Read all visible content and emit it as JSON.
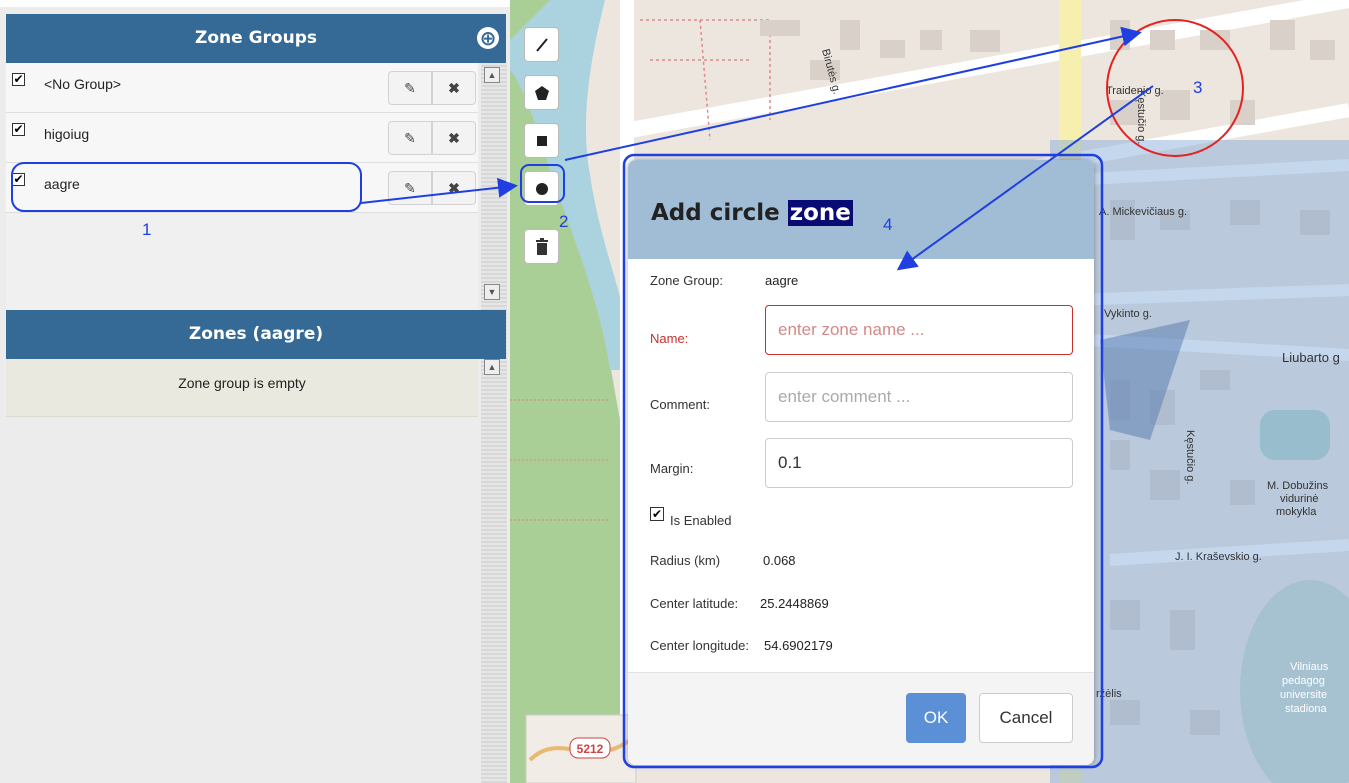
{
  "zone_groups": {
    "title": "Zone Groups",
    "add_symbol": "⊕",
    "edit_symbol": "✎",
    "delete_symbol": "✖",
    "items": [
      {
        "label": "<No Group>",
        "checked": true
      },
      {
        "label": "higoiug",
        "checked": true
      },
      {
        "label": "aagre",
        "checked": true
      }
    ]
  },
  "zones": {
    "title": "Zones (aagre)",
    "empty_text": "Zone group is empty"
  },
  "map": {
    "street_labels": [
      "Birutės g.",
      "Traidenio g.",
      "Kęstučio g.",
      "A. Mickevičiaus g.",
      "Vykinto g.",
      "Liubarto g",
      "Kęstučio g.",
      "J. I. Kraševskio g.",
      "M. Dobužins",
      "vidurinė",
      "mokykla",
      "Vilniaus",
      "pedagog",
      "universite",
      "stadiona",
      "ržėlis"
    ],
    "road_badge": "5212"
  },
  "modal": {
    "title_prefix": "Add circle",
    "title_highlight": "zone",
    "zone_group_label": "Zone Group:",
    "zone_group_value": "aagre",
    "name_label": "Name:",
    "name_placeholder": "enter zone name ...",
    "comment_label": "Comment:",
    "comment_placeholder": "enter comment ...",
    "margin_label": "Margin:",
    "margin_value": "0.1",
    "enabled_label": "Is Enabled",
    "enabled_checked": true,
    "radius_label": "Radius (km)",
    "radius_value": "0.068",
    "center_lat_label": "Center latitude:",
    "center_lat_value": "25.2448869",
    "center_lon_label": "Center longitude:",
    "center_lon_value": "54.6902179",
    "ok_label": "OK",
    "cancel_label": "Cancel"
  },
  "annotations": {
    "n1": "1",
    "n2": "2",
    "n3": "3",
    "n4": "4"
  },
  "colors": {
    "header": "#356a97",
    "modal_header": "#a1bdd6",
    "ok": "#5b8fd6",
    "annotation_blue": "#1f3fe0",
    "annotation_red": "#e52222",
    "name_error": "#c9302c"
  }
}
